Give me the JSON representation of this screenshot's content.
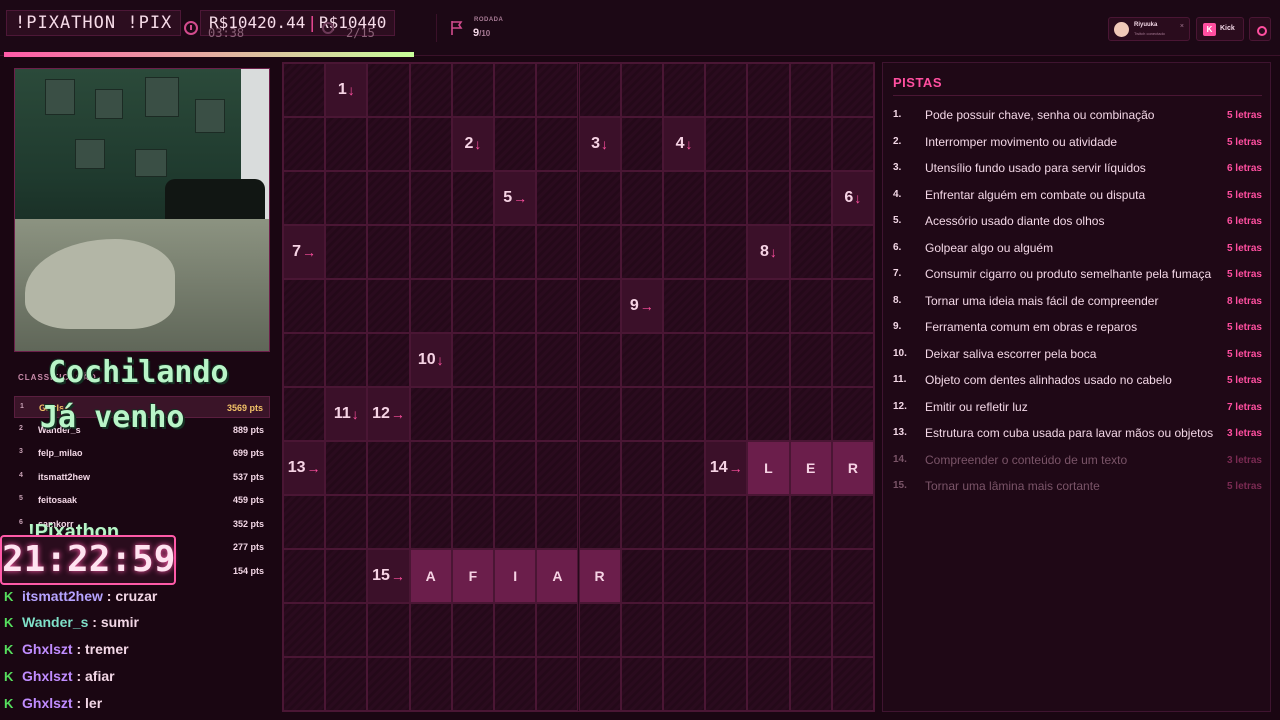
{
  "header": {
    "brand": "!PIXATHON !PIX",
    "prize_a": "R$10420.44",
    "prize_sep": "|",
    "prize_b": "R$10440",
    "timer": "03:38",
    "players": "2/15",
    "round_label": "RODADA",
    "round_current": "9",
    "round_total": "/10",
    "progress_fraction": 0.32,
    "user_name": "Riyuuka",
    "user_sub": "Twitch conectado",
    "user_close": "×",
    "kick_label": "Kick",
    "accent_color": "#ff4fa0"
  },
  "stream": {
    "status_line1": "Cochilando",
    "status_line2": "Já venho",
    "leaderboard_title": "CLASSIFICAÇÃO",
    "leaderboard": [
      {
        "rank": "1",
        "name": "Ghxlszt",
        "points": "3569 pts"
      },
      {
        "rank": "2",
        "name": "Wander_s",
        "points": "889 pts"
      },
      {
        "rank": "3",
        "name": "felp_milao",
        "points": "699 pts"
      },
      {
        "rank": "4",
        "name": "itsmatt2hew",
        "points": "537 pts"
      },
      {
        "rank": "5",
        "name": "feitosaak",
        "points": "459 pts"
      },
      {
        "rank": "6",
        "name": "samkorr",
        "points": "352 pts"
      },
      {
        "rank": "7",
        "name": "",
        "points": "277 pts"
      },
      {
        "rank": "8",
        "name": "",
        "points": "154 pts"
      }
    ],
    "pix_label": "!Pixathon",
    "pix_timer": "21:22:59",
    "chat": [
      {
        "user": "itsmatt2hew",
        "msg": " : cruzar"
      },
      {
        "user": "Wander_s",
        "msg": " : sumir"
      },
      {
        "user": "Ghxlszt",
        "msg": " : tremer"
      },
      {
        "user": "Ghxlszt",
        "msg": " : afiar"
      },
      {
        "user": "Ghxlszt",
        "msg": " : ler"
      }
    ]
  },
  "grid": {
    "clue_cells": [
      {
        "num": "1",
        "dir": "↓"
      },
      {
        "num": "2",
        "dir": "↓"
      },
      {
        "num": "3",
        "dir": "↓"
      },
      {
        "num": "4",
        "dir": "↓"
      },
      {
        "num": "5",
        "dir": "→"
      },
      {
        "num": "6",
        "dir": "↓"
      },
      {
        "num": "7",
        "dir": "→"
      },
      {
        "num": "8",
        "dir": "↓"
      },
      {
        "num": "9",
        "dir": "→"
      },
      {
        "num": "10",
        "dir": "↓"
      },
      {
        "num": "11",
        "dir": "↓"
      },
      {
        "num": "12",
        "dir": "→"
      },
      {
        "num": "13",
        "dir": "→"
      },
      {
        "num": "14",
        "dir": "→"
      },
      {
        "num": "15",
        "dir": "→"
      }
    ],
    "letters_14": [
      "L",
      "E",
      "R"
    ],
    "letters_15": [
      "A",
      "F",
      "I",
      "A",
      "R"
    ]
  },
  "clues": {
    "title": "PISTAS",
    "items": [
      {
        "n": "1.",
        "text": "Pode possuir chave, senha ou combinação",
        "len": "5 letras",
        "done": false
      },
      {
        "n": "2.",
        "text": "Interromper movimento ou atividade",
        "len": "5 letras",
        "done": false
      },
      {
        "n": "3.",
        "text": "Utensílio fundo usado para servir líquidos",
        "len": "6 letras",
        "done": false
      },
      {
        "n": "4.",
        "text": "Enfrentar alguém em combate ou disputa",
        "len": "5 letras",
        "done": false
      },
      {
        "n": "5.",
        "text": "Acessório usado diante dos olhos",
        "len": "6 letras",
        "done": false
      },
      {
        "n": "6.",
        "text": "Golpear algo ou alguém",
        "len": "5 letras",
        "done": false
      },
      {
        "n": "7.",
        "text": "Consumir cigarro ou produto semelhante pela fumaça",
        "len": "5 letras",
        "done": false
      },
      {
        "n": "8.",
        "text": "Tornar uma ideia mais fácil de compreender",
        "len": "8 letras",
        "done": false
      },
      {
        "n": "9.",
        "text": "Ferramenta comum em obras e reparos",
        "len": "5 letras",
        "done": false
      },
      {
        "n": "10.",
        "text": "Deixar saliva escorrer pela boca",
        "len": "5 letras",
        "done": false
      },
      {
        "n": "11.",
        "text": "Objeto com dentes alinhados usado no cabelo",
        "len": "5 letras",
        "done": false
      },
      {
        "n": "12.",
        "text": "Emitir ou refletir luz",
        "len": "7 letras",
        "done": false
      },
      {
        "n": "13.",
        "text": "Estrutura com cuba usada para lavar mãos ou objetos",
        "len": "3 letras",
        "done": false
      },
      {
        "n": "14.",
        "text": "Compreender o conteúdo de um texto",
        "len": "3 letras",
        "done": true
      },
      {
        "n": "15.",
        "text": "Tornar uma lâmina mais cortante",
        "len": "5 letras",
        "done": true
      }
    ]
  }
}
